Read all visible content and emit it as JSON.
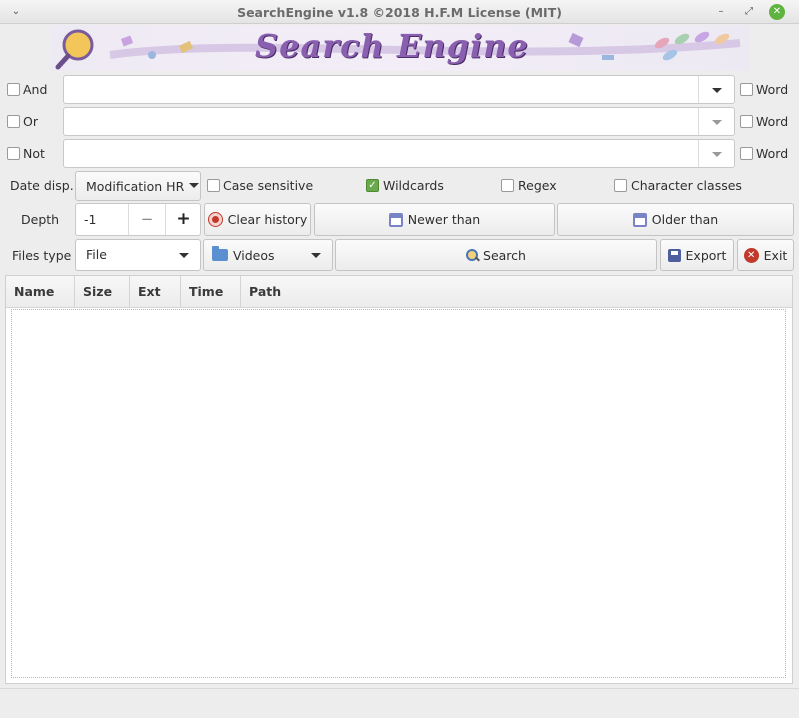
{
  "window": {
    "title": "SearchEngine v1.8  ©2018 H.F.M License (MIT)",
    "banner_text": "Search Engine"
  },
  "query": {
    "and_label": "And",
    "or_label": "Or",
    "not_label": "Not",
    "and_value": "",
    "or_value": "",
    "not_value": "",
    "word_label": "Word"
  },
  "options": {
    "date_label": "Date disp.",
    "date_selected": "Modification HR",
    "case_sensitive": {
      "label": "Case sensitive",
      "checked": false
    },
    "wildcards": {
      "label": "Wildcards",
      "checked": true
    },
    "regex": {
      "label": "Regex",
      "checked": false
    },
    "char_classes": {
      "label": "Character classes",
      "checked": false
    }
  },
  "depth": {
    "label": "Depth",
    "value": "-1",
    "minus": "−",
    "plus": "+"
  },
  "history": {
    "clear": "Clear history",
    "newer": "Newer than",
    "older": "Older  than"
  },
  "files": {
    "label": "Files type",
    "type_selected": "File",
    "category_selected": "Videos",
    "search": "Search",
    "export": "Export",
    "exit": "Exit"
  },
  "table": {
    "columns": [
      "Name",
      "Size",
      "Ext",
      "Time",
      "Path"
    ]
  },
  "colors": {
    "accent_green": "#6aaa4c",
    "exit_red": "#c0392b",
    "calendar": "#7b83c7"
  }
}
